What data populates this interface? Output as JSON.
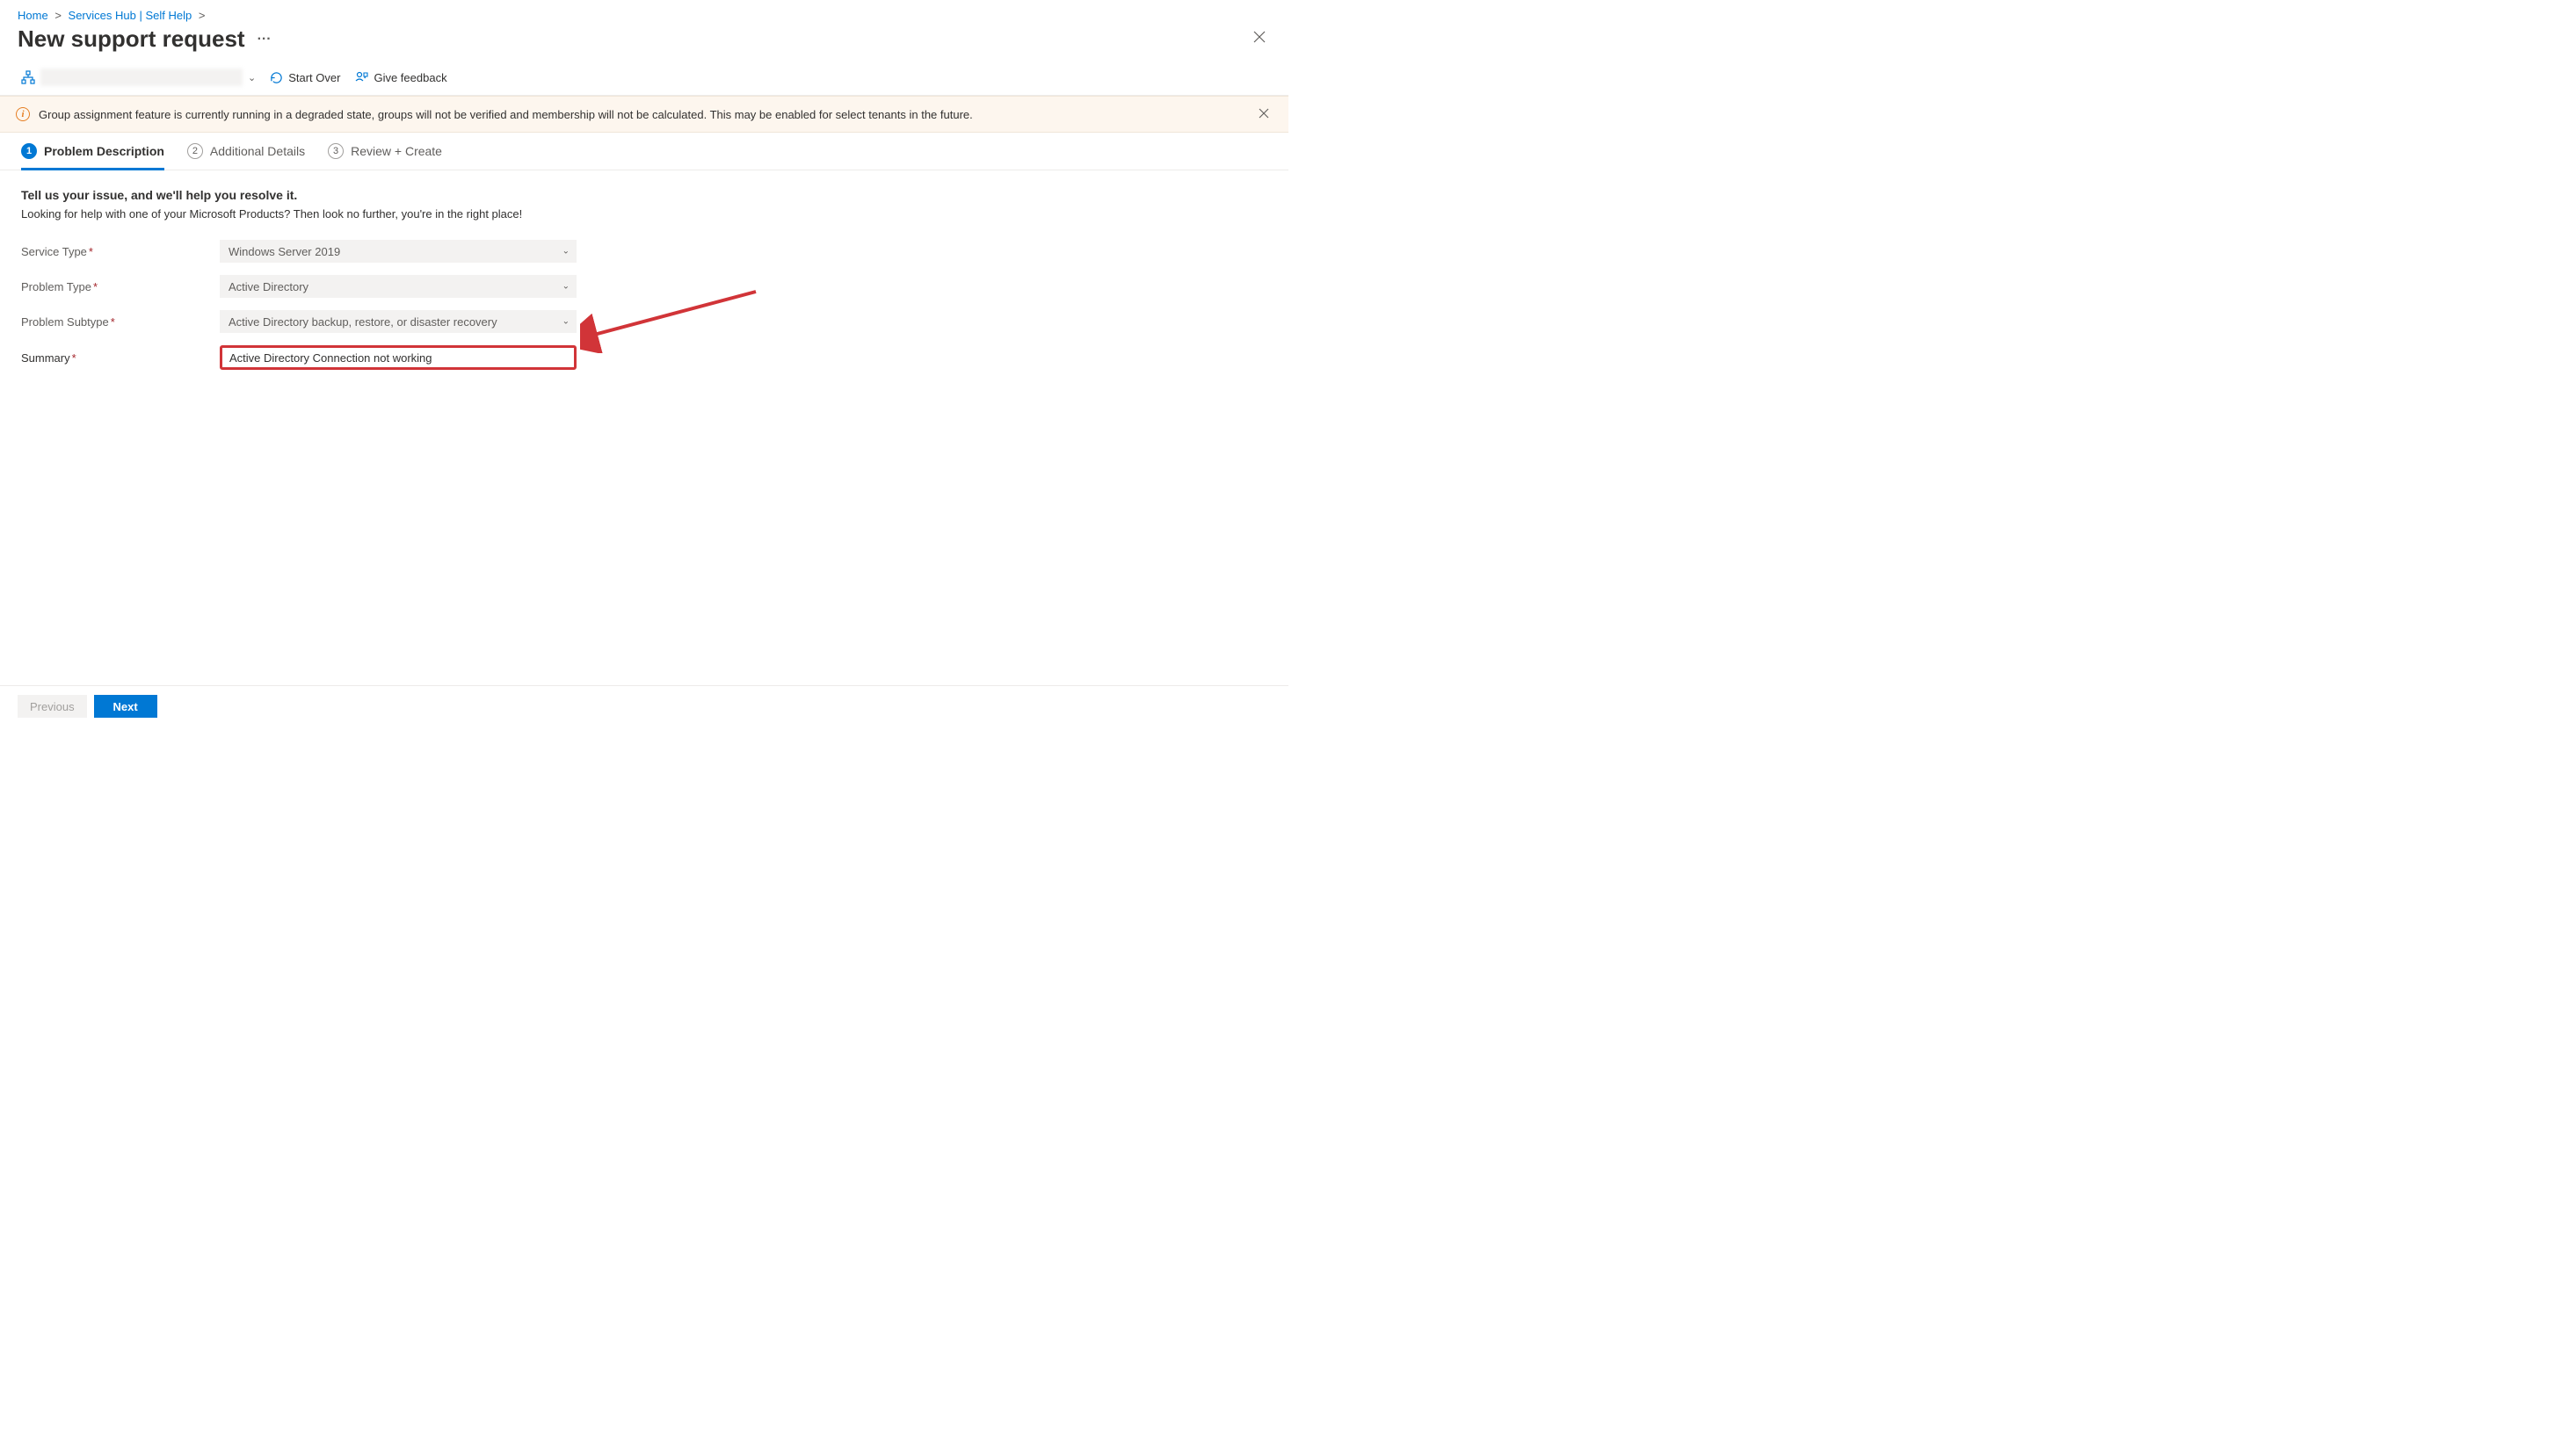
{
  "breadcrumb": {
    "home": "Home",
    "services_hub": "Services Hub | Self Help"
  },
  "page_title": "New support request",
  "toolbar": {
    "start_over": "Start Over",
    "give_feedback": "Give feedback"
  },
  "alert": {
    "text": "Group assignment feature is currently running in a degraded state, groups will not be verified and membership will not be calculated. This may be enabled for select tenants in the future."
  },
  "tabs": {
    "t1_num": "1",
    "t1_label": "Problem Description",
    "t2_num": "2",
    "t2_label": "Additional Details",
    "t3_num": "3",
    "t3_label": "Review + Create"
  },
  "form": {
    "heading": "Tell us your issue, and we'll help you resolve it.",
    "sub": "Looking for help with one of your Microsoft Products? Then look no further, you're in the right place!",
    "service_type_label": "Service Type",
    "service_type_value": "Windows Server 2019",
    "problem_type_label": "Problem Type",
    "problem_type_value": "Active Directory",
    "problem_subtype_label": "Problem Subtype",
    "problem_subtype_value": "Active Directory backup, restore, or disaster recovery",
    "summary_label": "Summary",
    "summary_value": "Active Directory Connection not working"
  },
  "footer": {
    "previous": "Previous",
    "next": "Next"
  }
}
